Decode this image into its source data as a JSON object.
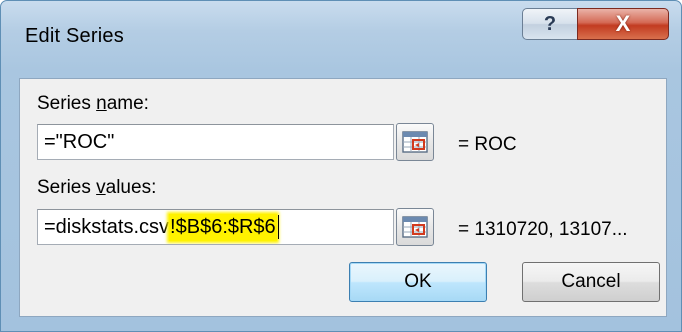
{
  "window": {
    "title": "Edit Series",
    "help_glyph": "?",
    "close_glyph": "X"
  },
  "series_name": {
    "label_prefix": "Series ",
    "label_accel": "n",
    "label_suffix": "ame:",
    "value": "=\"ROC\"",
    "result": "= ROC"
  },
  "series_values": {
    "label_prefix": "Series ",
    "label_accel": "v",
    "label_suffix": "alues:",
    "value_plain": "=diskstats.csv",
    "value_highlighted": "!$B$6:$R$6",
    "result": "= 1310720, 13107..."
  },
  "buttons": {
    "ok": "OK",
    "cancel": "Cancel"
  },
  "icons": {
    "collapse_dialog": "range-select-icon",
    "help": "help-icon",
    "close": "close-icon"
  },
  "colors": {
    "highlight": "#fff200",
    "close_button": "#c23b21",
    "title_gradient": "#b4cde4"
  }
}
